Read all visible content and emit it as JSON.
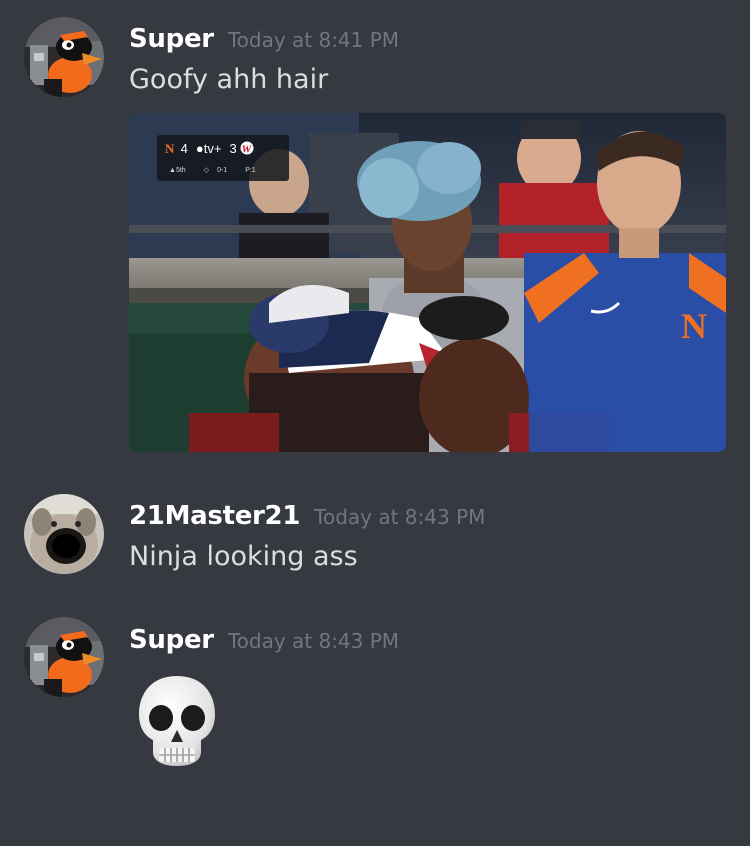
{
  "messages": [
    {
      "username": "Super",
      "timestamp": "Today at 8:41 PM",
      "text": "Goofy ahh hair",
      "attachment": {
        "scorebug": {
          "away_score": "4",
          "network": "tv+",
          "home_score": "3",
          "inning": "5th",
          "count": "0-1",
          "pitches": "P:1"
        }
      }
    },
    {
      "username": "21Master21",
      "timestamp": "Today at 8:43 PM",
      "text": "Ninja looking ass"
    },
    {
      "username": "Super",
      "timestamp": "Today at 8:43 PM",
      "emoji": "skull"
    }
  ],
  "colors": {
    "background": "#36393f",
    "username": "#ffffff",
    "timestamp": "#72767d",
    "message_text": "#dcddde"
  }
}
